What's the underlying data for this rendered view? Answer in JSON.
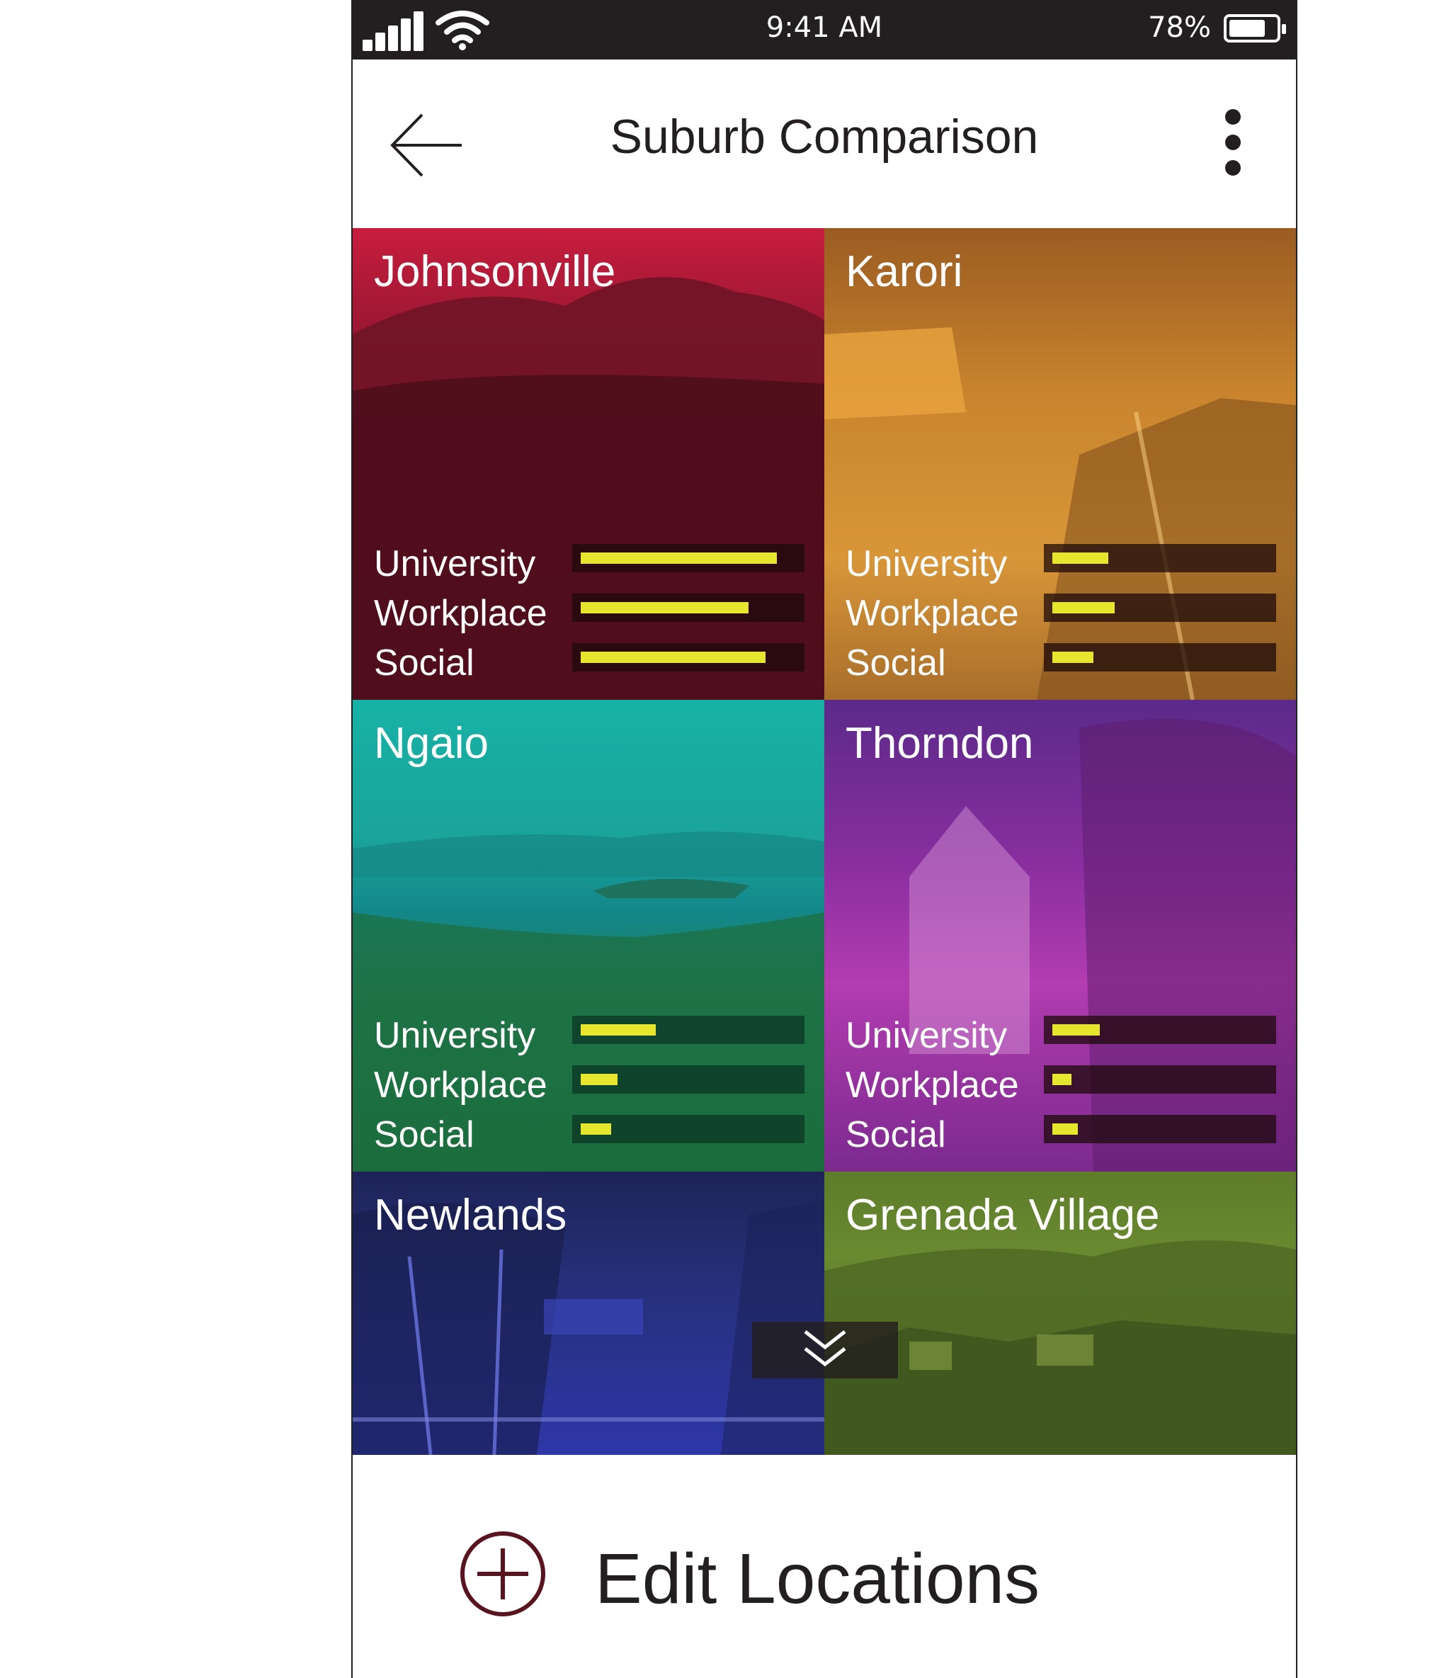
{
  "status_bar": {
    "time": "9:41 AM",
    "battery": "78%",
    "battery_level": 0.78
  },
  "header": {
    "title": "Suburb Comparison"
  },
  "suburbs": [
    {
      "name": "Johnsonville",
      "color": "#b7173a",
      "metrics": [
        {
          "label": "University",
          "level": 0.91
        },
        {
          "label": "Workplace",
          "level": 0.78
        },
        {
          "label": "Social",
          "level": 0.86
        }
      ]
    },
    {
      "name": "Karori",
      "color": "#d68a2a",
      "metrics": [
        {
          "label": "University",
          "level": 0.26
        },
        {
          "label": "Workplace",
          "level": 0.29
        },
        {
          "label": "Social",
          "level": 0.19
        }
      ]
    },
    {
      "name": "Ngaio",
      "color": "#16a79b",
      "metrics": [
        {
          "label": "University",
          "level": 0.35
        },
        {
          "label": "Workplace",
          "level": 0.17
        },
        {
          "label": "Social",
          "level": 0.14
        }
      ]
    },
    {
      "name": "Thorndon",
      "color": "#a02fa8",
      "metrics": [
        {
          "label": "University",
          "level": 0.22
        },
        {
          "label": "Workplace",
          "level": 0.09
        },
        {
          "label": "Social",
          "level": 0.12
        }
      ]
    },
    {
      "name": "Newlands",
      "color": "#2b2fa0"
    },
    {
      "name": "Grenada Village",
      "color": "#5f7d2c"
    }
  ],
  "footer": {
    "edit_label": "Edit Locations"
  },
  "icons": {
    "back": "arrow-left-icon",
    "menu": "more-vertical-icon",
    "scroll": "double-chevron-down-icon",
    "add": "plus-circle-icon"
  }
}
